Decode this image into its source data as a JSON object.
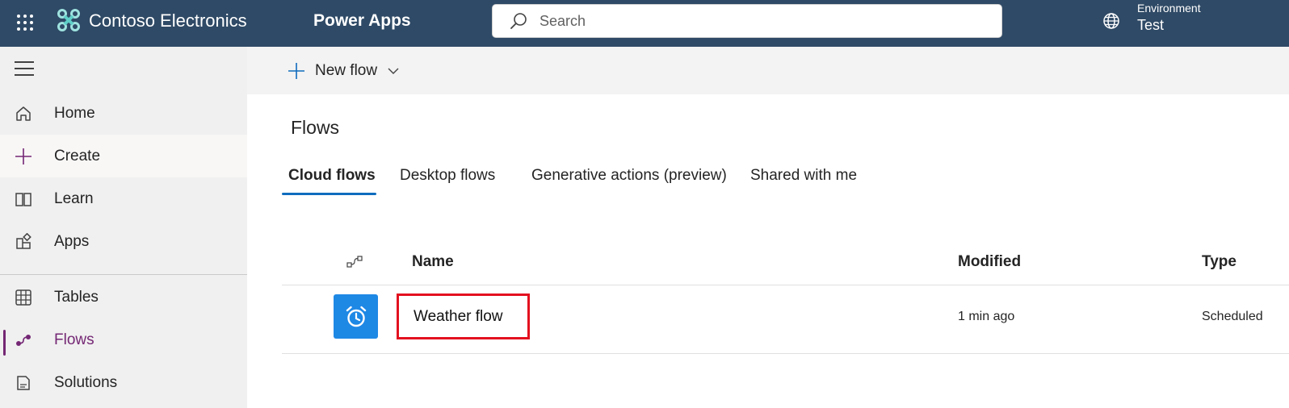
{
  "header": {
    "brand": "Contoso Electronics",
    "product": "Power Apps",
    "search_placeholder": "Search",
    "environment_label": "Environment",
    "environment_value": "Test",
    "bg_color": "#2f4a66"
  },
  "sidebar": {
    "items": [
      {
        "label": "Home",
        "icon": "home-icon"
      },
      {
        "label": "Create",
        "icon": "plus-icon"
      },
      {
        "label": "Learn",
        "icon": "book-icon"
      },
      {
        "label": "Apps",
        "icon": "apps-icon"
      },
      {
        "label": "Tables",
        "icon": "table-icon"
      },
      {
        "label": "Flows",
        "icon": "flow-icon"
      },
      {
        "label": "Solutions",
        "icon": "solutions-icon"
      }
    ],
    "active_item": "Flows",
    "accent_color": "#742774"
  },
  "command_bar": {
    "new_flow_label": "New flow"
  },
  "page": {
    "title": "Flows",
    "tabs": [
      {
        "label": "Cloud flows",
        "active": true
      },
      {
        "label": "Desktop flows",
        "active": false
      },
      {
        "label": "Generative actions (preview)",
        "active": false
      },
      {
        "label": "Shared with me",
        "active": false
      }
    ]
  },
  "table": {
    "columns": [
      "Name",
      "Modified",
      "Type"
    ],
    "rows": [
      {
        "name": "Weather flow",
        "modified": "1 min ago",
        "type": "Scheduled",
        "icon": "alarm-clock-icon"
      }
    ]
  }
}
